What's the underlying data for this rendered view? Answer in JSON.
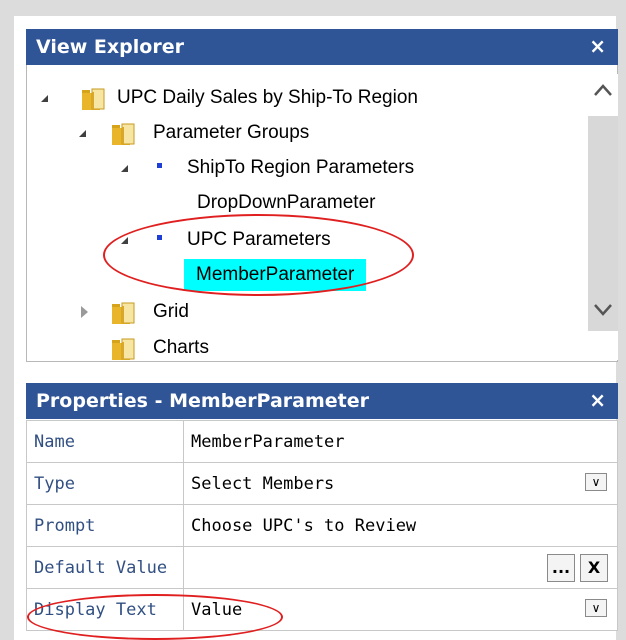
{
  "view_explorer": {
    "title": "View Explorer",
    "close_glyph": "×",
    "tree": [
      {
        "label": "UPC Daily Sales by Ship-To Region",
        "icon": "folder-icon",
        "expanded": true
      },
      {
        "label": "Parameter Groups",
        "icon": "folder-icon",
        "expanded": true
      },
      {
        "label": "ShipTo Region Parameters",
        "icon": "bullet-icon",
        "expanded": true
      },
      {
        "label": "DropDownParameter",
        "icon": null
      },
      {
        "label": "UPC Parameters",
        "icon": "bullet-icon",
        "expanded": true
      },
      {
        "label": "MemberParameter",
        "icon": null,
        "selected": true
      },
      {
        "label": "Grid",
        "icon": "folder-icon",
        "expanded": false
      },
      {
        "label": "Charts",
        "icon": "folder-icon"
      }
    ],
    "scroll_up_glyph": "^",
    "scroll_down_glyph": "v",
    "selected_highlight_color": "#00ffff"
  },
  "properties": {
    "title": "Properties - MemberParameter",
    "close_glyph": "×",
    "rows": [
      {
        "key": "Name",
        "value": "MemberParameter"
      },
      {
        "key": "Type",
        "value": "Select Members",
        "dropdown_glyph": "∨"
      },
      {
        "key": "Prompt",
        "value": "Choose UPC's to Review"
      },
      {
        "key": "Default Value",
        "value": "",
        "ellipsis_button": "...",
        "clear_button": "X"
      },
      {
        "key": "Display Text",
        "value": "Value",
        "dropdown_glyph": "∨"
      }
    ]
  },
  "colors": {
    "header_bg": "#2f5597",
    "header_text": "#ffffff",
    "annotation_red": "#e02020",
    "property_key_text": "#314f82"
  }
}
